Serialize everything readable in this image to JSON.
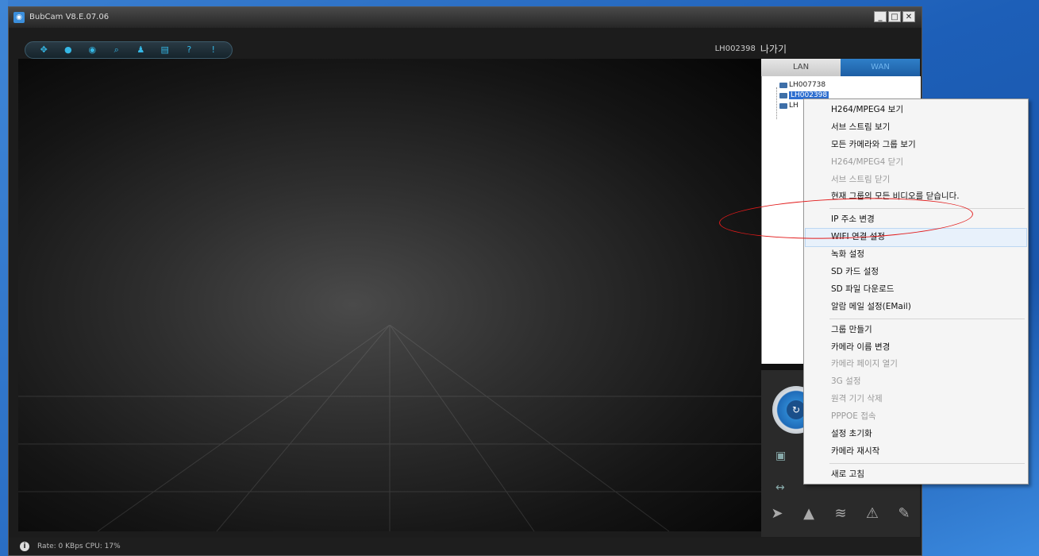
{
  "window": {
    "title": "BubCam V8.E.07.06",
    "minimize_icon": "minimize-icon",
    "maximize_icon": "maximize-icon",
    "close_icon": "close-icon"
  },
  "header": {
    "user_id": "LH002398",
    "logout_label": "나가기"
  },
  "toolbar": {
    "icons": [
      "layout-icon",
      "camera-icon",
      "record-icon",
      "search-icon",
      "user-icon",
      "save-icon",
      "help-icon",
      "info-icon"
    ]
  },
  "tabs": {
    "lan": "LAN",
    "wan": "WAN"
  },
  "devices": [
    {
      "name": "LH007738"
    },
    {
      "name": "LH002398"
    },
    {
      "name": "LH"
    }
  ],
  "status": {
    "text": "Rate: 0 KBps  CPU:  17%"
  },
  "context_menu": {
    "items": [
      {
        "label": "H264/MPEG4 보기",
        "enabled": true
      },
      {
        "label": "서브 스트림 보기",
        "enabled": true
      },
      {
        "label": "모든 카메라와 그룹 보기",
        "enabled": true
      },
      {
        "label": "H264/MPEG4 닫기",
        "enabled": false
      },
      {
        "label": "서브 스트림 닫기",
        "enabled": false
      },
      {
        "label": "현재 그룹의 모든 비디오를 닫습니다.",
        "enabled": true
      },
      {
        "label": "IP 주소 변경",
        "enabled": true
      },
      {
        "label": "WIFI 연결 설정",
        "enabled": true
      },
      {
        "label": "녹화 설정",
        "enabled": true
      },
      {
        "label": "SD 카드 설정",
        "enabled": true
      },
      {
        "label": "SD 파일 다운로드",
        "enabled": true
      },
      {
        "label": "알람 메일 설정(EMail)",
        "enabled": true
      },
      {
        "label": "그룹 만들기",
        "enabled": true
      },
      {
        "label": "카메라 이름 변경",
        "enabled": true
      },
      {
        "label": "카메라 페이지 열기",
        "enabled": false
      },
      {
        "label": "3G 설정",
        "enabled": false
      },
      {
        "label": "원격 기기 삭제",
        "enabled": false
      },
      {
        "label": "PPPOE 접속",
        "enabled": false
      },
      {
        "label": "설정 초기화",
        "enabled": true
      },
      {
        "label": "카메라 재시작",
        "enabled": true
      },
      {
        "label": "새로 고침",
        "enabled": true
      }
    ]
  }
}
